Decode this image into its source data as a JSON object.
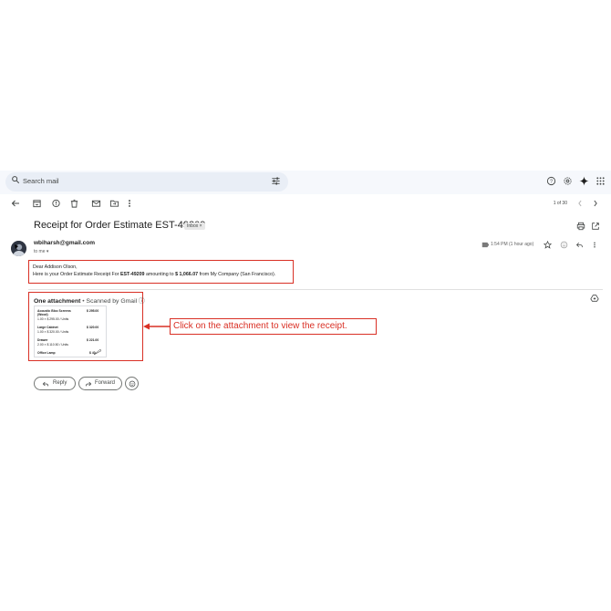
{
  "search": {
    "placeholder": "Search mail"
  },
  "toolbar": {
    "pagination": "1 of 30"
  },
  "message": {
    "subject": "Receipt for Order Estimate EST-49209",
    "label_chip": "Inbox ×",
    "sender": "wbiharsh@gmail.com",
    "to_me": "to me ▾",
    "time": "1:54 PM (1 hour ago)",
    "greeting": "Dear Addison Olson,",
    "body_prefix": "Here is your Order Estimate Receipt For ",
    "body_estimate": "EST-49209",
    "body_middle": " amounting to ",
    "body_amount": "$ 1,066.07",
    "body_suffix": " from My Company (San Francisco)."
  },
  "attachment": {
    "count_label": "One attachment",
    "dot": "•",
    "scanned_label": "Scanned by Gmail ⓘ",
    "items": [
      {
        "name": "Acoustic Bloc Screens",
        "name2": "(Wood)",
        "qty": "1.00 × $ 295.00 / Units",
        "price": "$ 295.00"
      },
      {
        "name": "Large Cabinet",
        "qty": "1.00 × $ 320.00 / Units",
        "price": "$ 320.00"
      },
      {
        "name": "Drawer",
        "qty": "2.00 × $ 110.50 / Units",
        "price": "$ 221.00"
      },
      {
        "name": "Office Lamp",
        "price": "$ 40"
      }
    ]
  },
  "annotation": {
    "text": "Click on the attachment to view the receipt."
  },
  "actions": {
    "reply": "Reply",
    "forward": "Forward"
  },
  "colors": {
    "highlight": "#d93025",
    "search_bg": "#e9eef6",
    "topbar_bg": "#f6f8fc"
  }
}
